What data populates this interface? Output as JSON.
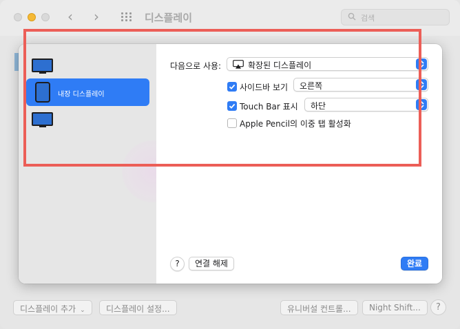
{
  "window": {
    "title": "디스플레이",
    "search_placeholder": "검색",
    "nav_back": "‹",
    "nav_forward": "›"
  },
  "bottom_bar": {
    "add_display": "디스플레이 추가",
    "display_settings": "디스플레이 설정...",
    "universal_control": "유니버설 컨트롤...",
    "night_shift": "Night Shift...",
    "help": "?"
  },
  "sheet": {
    "displays": [
      {
        "type": "monitor",
        "label": ""
      },
      {
        "type": "ipad",
        "label": "내장 디스플레이",
        "selected": true
      },
      {
        "type": "monitor",
        "label": ""
      }
    ],
    "use_as_label": "다음으로 사용:",
    "use_as_value": "확장된 디스플레이",
    "show_sidebar_label": "사이드바 보기",
    "show_sidebar_checked": true,
    "sidebar_position_value": "오른쪽",
    "show_touchbar_label": "Touch Bar 표시",
    "show_touchbar_checked": true,
    "touchbar_position_value": "하단",
    "apple_pencil_label": "Apple Pencil의 이중 탭 활성화",
    "apple_pencil_checked": false,
    "help": "?",
    "disconnect_label": "연결 해제",
    "done_label": "완료"
  },
  "colors": {
    "accent": "#2f7cf5",
    "annotation": "#ec5e57"
  }
}
